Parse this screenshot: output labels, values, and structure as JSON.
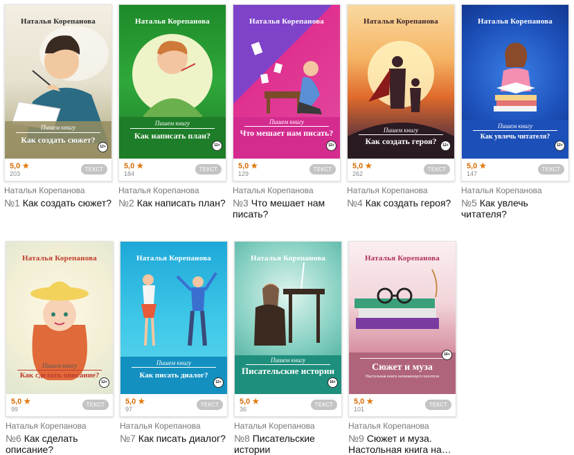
{
  "colors": {
    "rating": "#d86a00",
    "badge_bg": "#c4c4c4",
    "author": "#777777"
  },
  "books": [
    {
      "num": "№1",
      "title": "Как создать сюжет?",
      "author": "Наталья Корепанова",
      "cover_author": "Наталья Корепанова",
      "cover_series": "Пишем книгу",
      "cover_title": "Как создать сюжет?",
      "age": "12+",
      "rating": "5,0",
      "count": "203",
      "badge": "ТЕКСТ",
      "icon": "star-icon"
    },
    {
      "num": "№2",
      "title": "Как написать план?",
      "author": "Наталья Корепанова",
      "cover_author": "Наталья Корепанова",
      "cover_series": "Пишем книгу",
      "cover_title": "Как написать план?",
      "age": "12+",
      "rating": "5,0",
      "count": "184",
      "badge": "ТЕКСТ",
      "icon": "star-icon"
    },
    {
      "num": "№3",
      "title": "Что мешает нам писать?",
      "author": "Наталья Корепанова",
      "cover_author": "Наталья Корепанова",
      "cover_series": "Пишем книгу",
      "cover_title": "Что мешает нам писать?",
      "age": "12+",
      "rating": "5,0",
      "count": "129",
      "badge": "ТЕКСТ",
      "icon": "star-icon"
    },
    {
      "num": "№4",
      "title": "Как создать героя?",
      "author": "Наталья Корепанова",
      "cover_author": "Наталья Корепанова",
      "cover_series": "Пишем книгу",
      "cover_title": "Как создать героя?",
      "age": "12+",
      "rating": "5,0",
      "count": "262",
      "badge": "ТЕКСТ",
      "icon": "star-icon"
    },
    {
      "num": "№5",
      "title": "Как увлечь читателя?",
      "author": "Наталья Корепанова",
      "cover_author": "Наталья Корепанова",
      "cover_series": "Пишем книгу",
      "cover_title": "Как увлечь читателя?",
      "age": "12+",
      "rating": "5,0",
      "count": "147",
      "badge": "ТЕКСТ",
      "icon": "star-icon"
    },
    {
      "num": "№6",
      "title": "Как сделать описание?",
      "author": "Наталья Корепанова",
      "cover_author": "Наталья Корепанова",
      "cover_series": "Пишем книгу",
      "cover_title": "Как сделать описание?",
      "age": "12+",
      "rating": "5,0",
      "count": "99",
      "badge": "ТЕКСТ",
      "icon": "star-icon"
    },
    {
      "num": "№7",
      "title": "Как писать диалог?",
      "author": "Наталья Корепанова",
      "cover_author": "Наталья Корепанова",
      "cover_series": "Пишем книгу",
      "cover_title": "Как писать диалог?",
      "age": "12+",
      "rating": "5,0",
      "count": "97",
      "badge": "ТЕКСТ",
      "icon": "star-icon"
    },
    {
      "num": "№8",
      "title": "Писательские истории",
      "author": "Наталья Корепанова",
      "cover_author": "Наталья Корепанова",
      "cover_series": "Пишем книгу",
      "cover_title": "Писательские истории",
      "age": "16+",
      "rating": "5,0",
      "count": "36",
      "badge": "ТЕКСТ",
      "icon": "star-icon"
    },
    {
      "num": "№9",
      "title": "Сюжет и муза. Настольная книга на…",
      "author": "Наталья Корепанова",
      "cover_author": "Наталья Корепанова",
      "cover_series": "",
      "cover_title": "Сюжет и муза",
      "cover_subtitle": "Настольная книга начинающего писателя",
      "age": "16+",
      "rating": "5,0",
      "count": "101",
      "badge": "ТЕКСТ",
      "icon": "star-icon"
    }
  ]
}
